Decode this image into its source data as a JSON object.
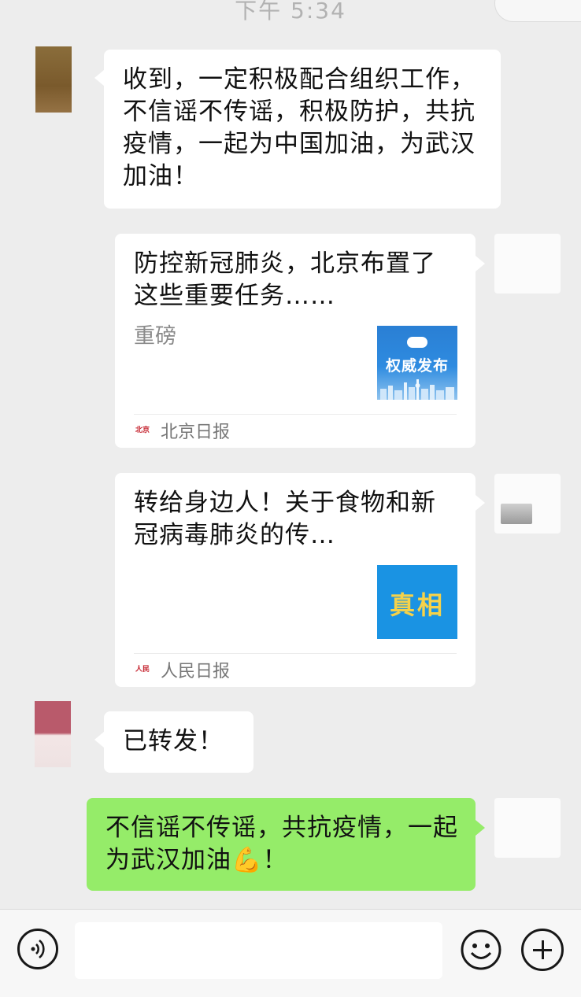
{
  "chat": {
    "timestamp": "下午 5:34",
    "messages": [
      {
        "sender": "other",
        "avatar_icon": "user-avatar-icon",
        "text": "收到，一定积极配合组织工作，不信谣不传谣，积极防护，共抗疫情，一起为中国加油，为武汉加油！"
      },
      {
        "sender": "self",
        "type": "article",
        "title": "防控新冠肺炎，北京布置了这些重要任务……",
        "description": "重磅",
        "thumbnail_text": "权威发布",
        "source": "北京日报",
        "source_logo_text": "北京日报",
        "thumb_logo_text": "北京日报"
      },
      {
        "sender": "self",
        "type": "article",
        "title": "转给身边人！关于食物和新冠病毒肺炎的传…",
        "description": "",
        "thumbnail_text": "真相",
        "source": "人民日报",
        "source_logo_text": "人民日报"
      },
      {
        "sender": "other",
        "avatar_icon": "user-avatar-icon",
        "text": "已转发！"
      },
      {
        "sender": "self",
        "text": "不信谣不传谣，共抗疫情，一起为武汉加油💪！"
      }
    ]
  },
  "input_bar": {
    "voice_icon": "voice-icon",
    "input_value": "",
    "emoji_icon": "emoji-icon",
    "plus_icon": "plus-icon"
  },
  "colors": {
    "background": "#ededed",
    "self_bubble": "#95ec69",
    "other_bubble": "#ffffff",
    "card_thumb_blue": "#2a7fd4",
    "card_thumb_sky": "#1a93e3",
    "truth_text": "#f5d24a"
  }
}
